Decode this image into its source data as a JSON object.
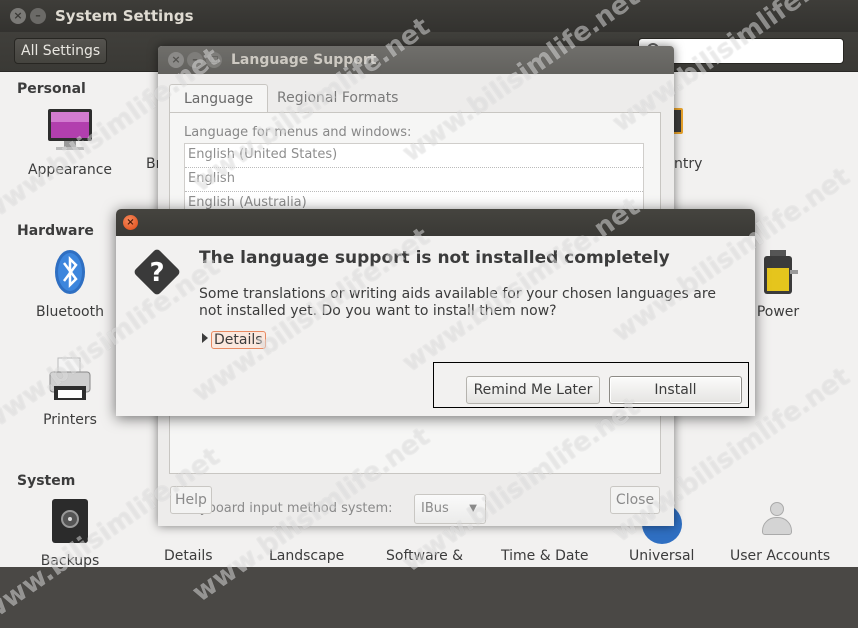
{
  "settings": {
    "title": "System Settings",
    "all_settings_label": "All Settings",
    "sections": {
      "personal": "Personal",
      "hardware": "Hardware",
      "system": "System"
    },
    "tiles": {
      "appearance": "Appearance",
      "brightness_partial": "Br",
      "country_partial": "ntry",
      "bluetooth": "Bluetooth",
      "power": "Power",
      "printers": "Printers",
      "backups": "Backups",
      "details": "Details",
      "landscape": "Landscape",
      "software": "Software &",
      "time_date": "Time & Date",
      "universal": "Universal",
      "user_accounts": "User Accounts"
    }
  },
  "language_support": {
    "title": "Language Support",
    "tabs": [
      "Language",
      "Regional Formats"
    ],
    "heading": "Language for menus and windows:",
    "languages": [
      "English (United States)",
      "English",
      "English (Australia)"
    ],
    "keyboard_label": "Keyboard input method system:",
    "keyboard_value": "IBus",
    "help_label": "Help",
    "close_label": "Close"
  },
  "dialog": {
    "heading": "The language support is not installed completely",
    "message": "Some translations or writing aids available for your chosen languages are not installed yet. Do you want to install them now?",
    "details_label": "Details",
    "remind_label": "Remind Me Later",
    "install_label": "Install"
  },
  "watermark": "www.bilisimlife.net",
  "colors": {
    "accent_orange": "#de4814",
    "dark_titlebar": "#3a3935"
  },
  "icons": [
    "close-icon",
    "minimize-icon",
    "maximize-icon",
    "search-icon",
    "question-icon",
    "bluetooth-icon",
    "battery-icon",
    "printer-icon",
    "safe-icon",
    "monitor-icon"
  ]
}
